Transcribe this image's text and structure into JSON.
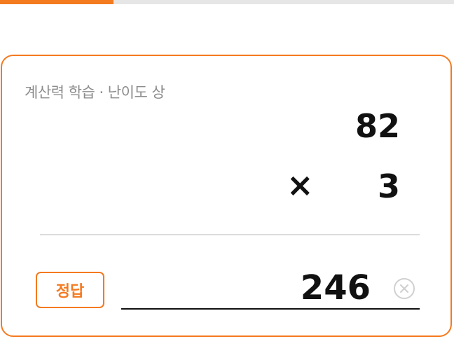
{
  "progress": {
    "fraction": 0.25
  },
  "subtitle": "계산력 학습 · 난이도 상",
  "problem": {
    "operand_1": "82",
    "operator": "×",
    "operand_2": "3"
  },
  "answer": {
    "button_label": "정답",
    "value": "246",
    "clear_icon": "clear-circle-x-icon"
  },
  "colors": {
    "accent": "#f47a20",
    "progress_track": "#e6e6e6",
    "text_primary": "#111111",
    "text_secondary": "#8c8c8c",
    "divider": "#dcdcdc"
  }
}
